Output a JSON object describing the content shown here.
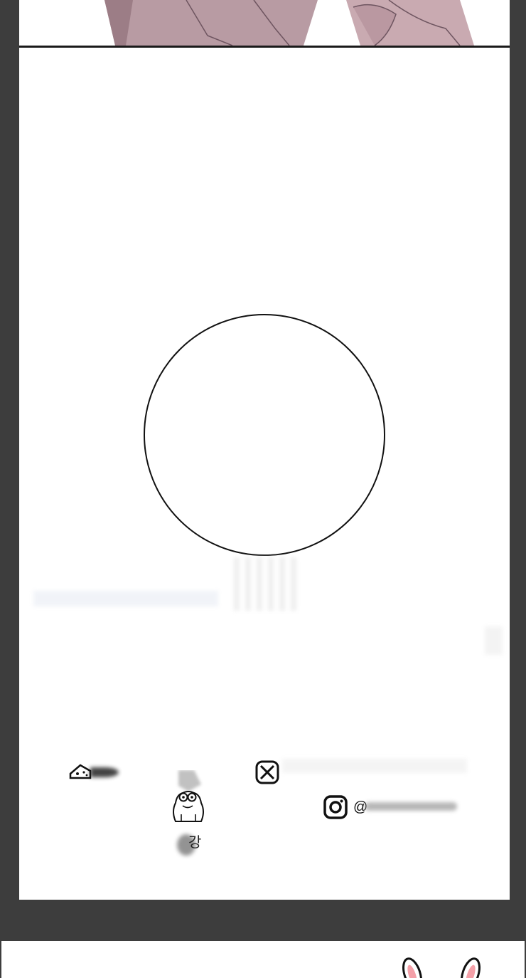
{
  "footer": {
    "cheese_handle": "",
    "mail_handle": "",
    "instagram_at": "@",
    "instagram_handle": ""
  },
  "mascot": {
    "label": "강"
  },
  "banner": {
    "title": ""
  },
  "colors": {
    "page_bg": "#3d3d3d",
    "panel_bg": "#ffffff",
    "banner_text": "#f26522",
    "bunny_ear_pink": "#f4a0a8"
  },
  "icons": [
    "cheese-icon",
    "mail-icon",
    "instagram-icon",
    "mascot-icon",
    "bunny-ears-icon"
  ]
}
